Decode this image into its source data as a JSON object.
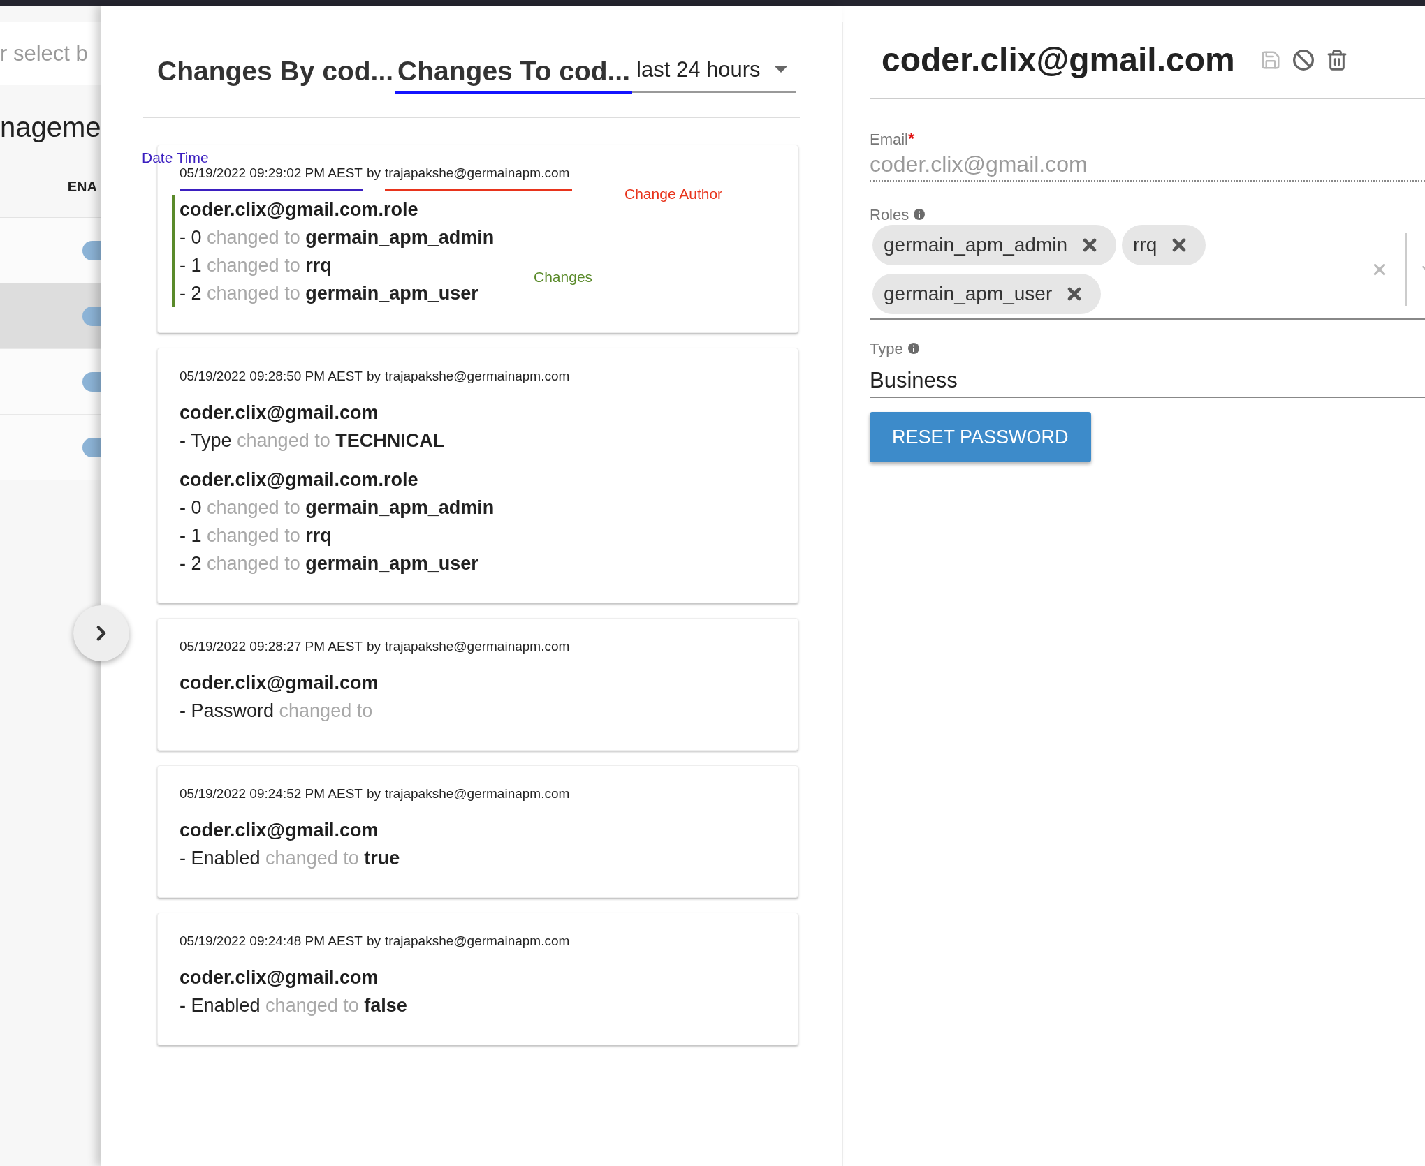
{
  "background": {
    "search": {
      "placeholder": "r select b"
    },
    "heading": "nageme",
    "column_header": "ENA",
    "rows": [
      {
        "selected": false,
        "on": true
      },
      {
        "selected": true,
        "on": true
      },
      {
        "selected": false,
        "on": true
      },
      {
        "selected": false,
        "on": true
      }
    ]
  },
  "history": {
    "tabs": [
      {
        "label": "Changes By cod...",
        "selected": false
      },
      {
        "label": "Changes To cod...",
        "selected": true
      }
    ],
    "period": {
      "value": "last 24 hours"
    },
    "entries": [
      {
        "timestamp": "05/19/2022 09:29:02 PM AEST",
        "by": "by",
        "author": "trajapakshe@germainapm.com",
        "annotations": [
          {
            "kind": "date_time",
            "label": "Date Time",
            "color": "#3b1fc0"
          },
          {
            "kind": "author",
            "label": "Change Author",
            "color": "#e8341c"
          },
          {
            "kind": "changes",
            "label": "Changes",
            "color": "#5a8a2a"
          }
        ],
        "groups": [
          {
            "title": "coder.clix@gmail.com.role",
            "changes": [
              {
                "field": "- 0",
                "verb": "changed to",
                "value": "germain_apm_admin"
              },
              {
                "field": "- 1",
                "verb": "changed to",
                "value": "rrq"
              },
              {
                "field": "- 2",
                "verb": "changed to",
                "value": "germain_apm_user"
              }
            ]
          }
        ]
      },
      {
        "timestamp": "05/19/2022 09:28:50 PM AEST",
        "by": "by",
        "author": "trajapakshe@germainapm.com",
        "groups": [
          {
            "title": "coder.clix@gmail.com",
            "changes": [
              {
                "field": "- Type",
                "verb": "changed to",
                "value": "TECHNICAL"
              }
            ]
          },
          {
            "title": "coder.clix@gmail.com.role",
            "changes": [
              {
                "field": "- 0",
                "verb": "changed to",
                "value": "germain_apm_admin"
              },
              {
                "field": "- 1",
                "verb": "changed to",
                "value": "rrq"
              },
              {
                "field": "- 2",
                "verb": "changed to",
                "value": "germain_apm_user"
              }
            ]
          }
        ]
      },
      {
        "timestamp": "05/19/2022 09:28:27 PM AEST",
        "by": "by",
        "author": "trajapakshe@germainapm.com",
        "groups": [
          {
            "title": "coder.clix@gmail.com",
            "changes": [
              {
                "field": "- Password",
                "verb": "changed to"
              }
            ]
          }
        ]
      },
      {
        "timestamp": "05/19/2022 09:24:52 PM AEST",
        "by": "by",
        "author": "trajapakshe@germainapm.com",
        "groups": [
          {
            "title": "coder.clix@gmail.com",
            "changes": [
              {
                "field": "- Enabled",
                "verb": "changed to",
                "value": "true"
              }
            ]
          }
        ]
      },
      {
        "timestamp": "05/19/2022 09:24:48 PM AEST",
        "by": "by",
        "author": "trajapakshe@germainapm.com",
        "groups": [
          {
            "title": "coder.clix@gmail.com",
            "changes": [
              {
                "field": "- Enabled",
                "verb": "changed to",
                "value": "false"
              }
            ]
          }
        ]
      }
    ]
  },
  "user": {
    "title": "coder.clix@gmail.com",
    "fields": [
      {
        "kind": "text",
        "label": "Email",
        "required_mark": "*",
        "disabled": true,
        "value": "coder.clix@gmail.com"
      },
      {
        "kind": "tags",
        "label": "Roles",
        "info": true,
        "tags": [
          "germain_apm_admin",
          "rrq",
          "germain_apm_user"
        ]
      },
      {
        "kind": "select",
        "label": "Type",
        "info": true,
        "value": "Business"
      }
    ],
    "button": "RESET PASSWORD"
  }
}
